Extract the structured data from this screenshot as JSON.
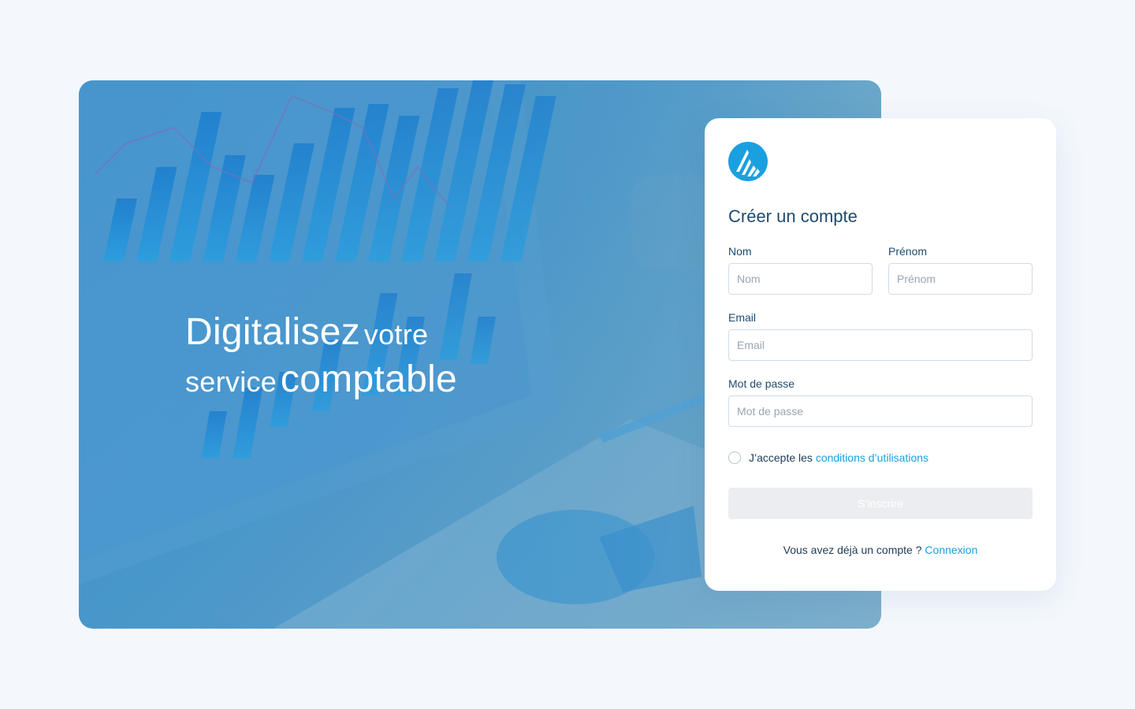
{
  "hero": {
    "line1_big": "Digitalisez",
    "line1_small": "votre",
    "line2_small": "service",
    "line2_big": "comptable"
  },
  "brand": {
    "logo_icon": "mountain-logo-icon",
    "accent_color": "#1aa0e0",
    "title_color": "#1f4a6e"
  },
  "form": {
    "title": "Créer un compte",
    "nom_label": "Nom",
    "nom_placeholder": "Nom",
    "prenom_label": "Prénom",
    "prenom_placeholder": "Prénom",
    "email_label": "Email",
    "email_placeholder": "Email",
    "password_label": "Mot de passe",
    "password_placeholder": "Mot de passe",
    "terms_prefix": "J’accepte les ",
    "terms_link": "conditions d’utilisations",
    "submit_label": "S’inscrire",
    "login_prompt": "Vous avez déjà un compte ? ",
    "login_link": "Connexion"
  }
}
